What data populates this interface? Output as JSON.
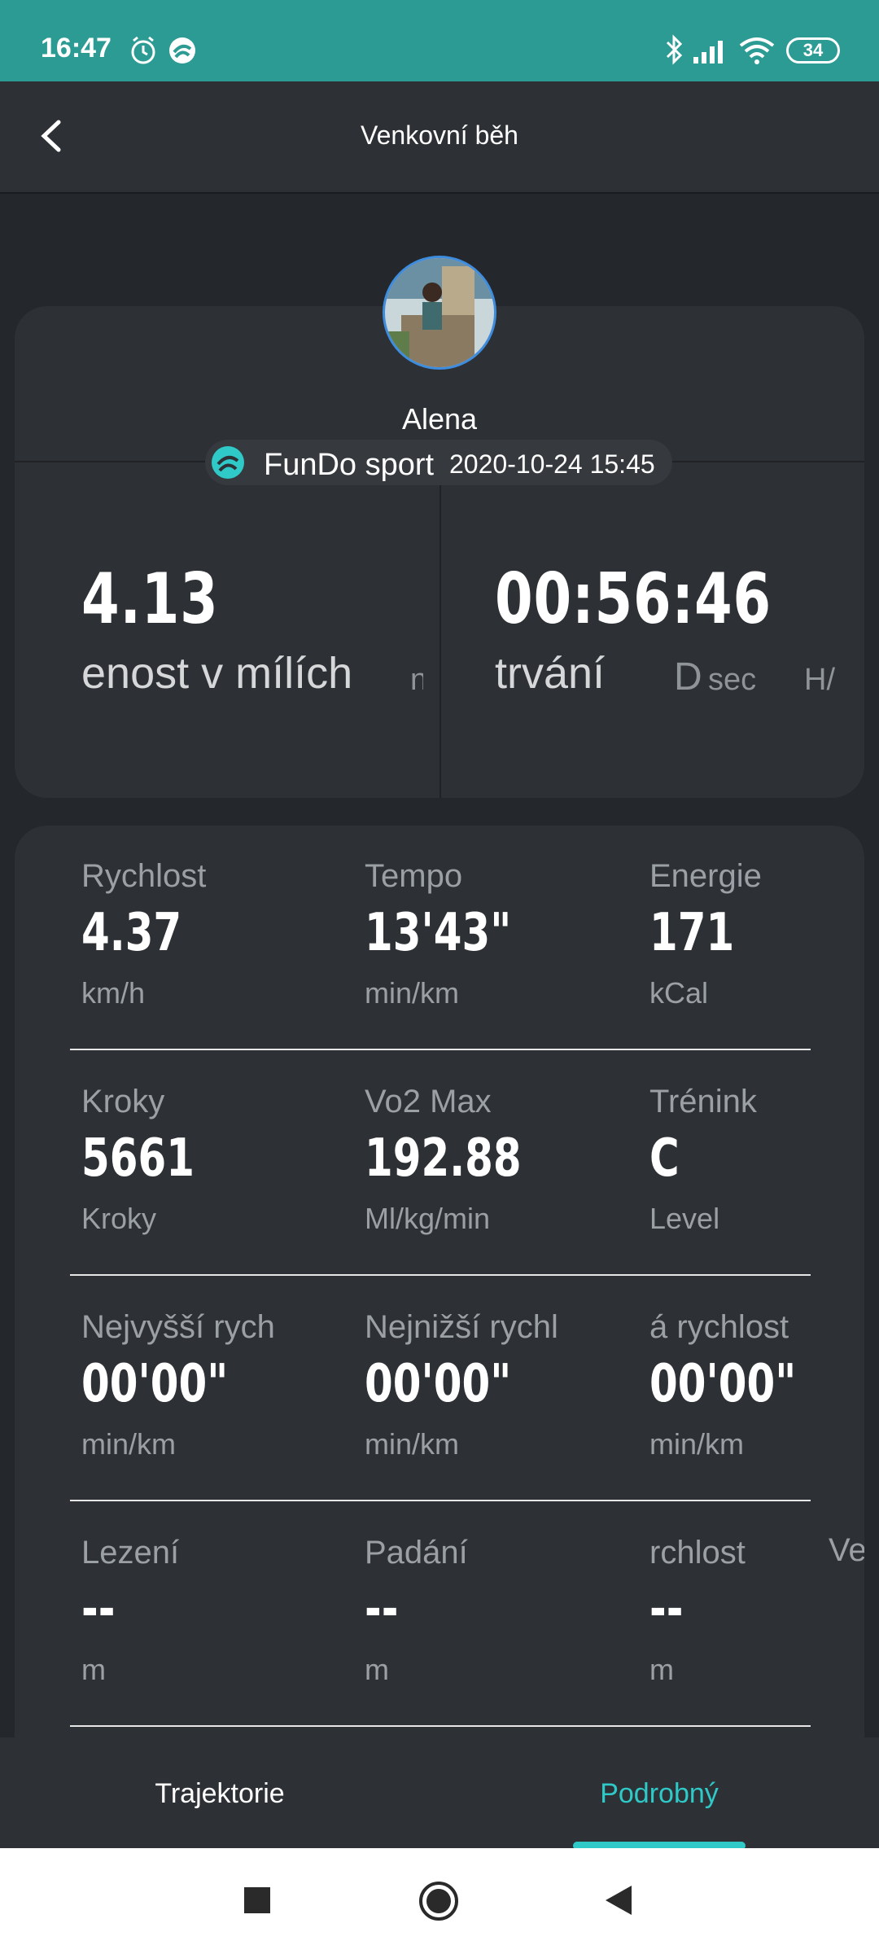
{
  "status_bar": {
    "time": "16:47",
    "battery": "34"
  },
  "header": {
    "title": "Venkovní běh"
  },
  "profile": {
    "name": "Alena",
    "source_app": "FunDo sport",
    "datetime": "2020-10-24 15:45"
  },
  "summary": {
    "distance_value": "4.13",
    "distance_label": "enost v mílích",
    "distance_label_faint": "n",
    "duration_value": "00:56:46",
    "duration_label": "trvání",
    "duration_faint_1": "D",
    "duration_faint_2": "sec",
    "duration_faint_3": "H/"
  },
  "stats": [
    [
      {
        "label": "Rychlost",
        "value": "4.37",
        "unit": "km/h"
      },
      {
        "label": "Tempo",
        "value": "13'43\"",
        "unit": "min/km"
      },
      {
        "label": "Energie",
        "value": "171",
        "unit": "kCal"
      }
    ],
    [
      {
        "label": "Kroky",
        "value": "5661",
        "unit": "Kroky"
      },
      {
        "label": "Vo2 Max",
        "value": "192.88",
        "unit": "Ml/kg/min"
      },
      {
        "label": "Trénink",
        "value": "C",
        "unit": "Level"
      }
    ],
    [
      {
        "label": "Nejvyšší rych",
        "value": "00'00\"",
        "unit": "min/km"
      },
      {
        "label": "Nejnižší rychl",
        "value": "00'00\"",
        "unit": "min/km"
      },
      {
        "label": "á rychlost",
        "value": "00'00\"",
        "unit": "min/km"
      }
    ],
    [
      {
        "label": "Lezení",
        "value": "--",
        "unit": "m"
      },
      {
        "label": "Padání",
        "value": "--",
        "unit": "m"
      },
      {
        "label": "rchlost",
        "value": "--",
        "unit": "m"
      }
    ]
  ],
  "stats_extra_label": "Ve",
  "tabs": {
    "left": "Trajektorie",
    "right": "Podrobný"
  },
  "colors": {
    "status_bar": "#2b9b93",
    "accent": "#2fc9c8",
    "card": "#2d3035",
    "background": "#24272b"
  }
}
